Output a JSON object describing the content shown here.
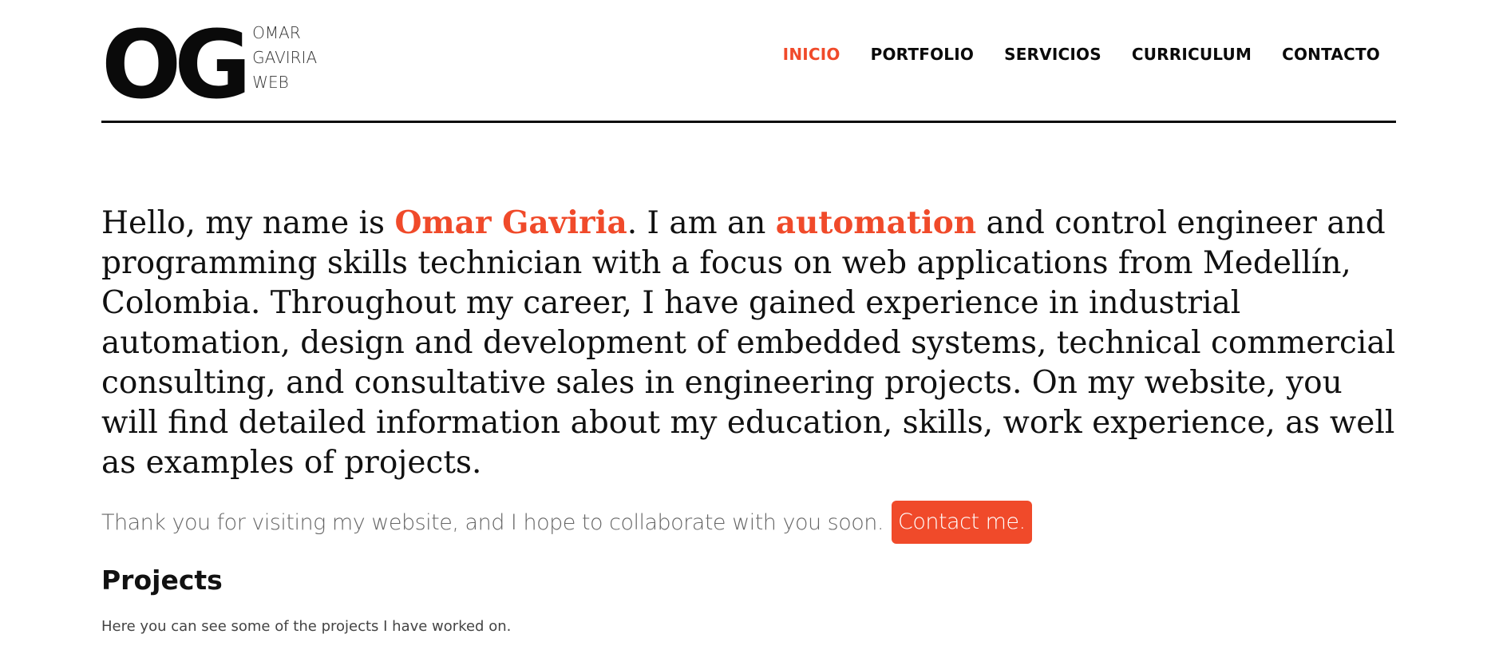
{
  "logo": {
    "mark": "OG",
    "line1": "OMAR",
    "line2": "GAVIRIA",
    "line3": "WEB"
  },
  "nav": {
    "items": [
      {
        "label": "INICIO",
        "active": true
      },
      {
        "label": "PORTFOLIO",
        "active": false
      },
      {
        "label": "SERVICIOS",
        "active": false
      },
      {
        "label": "CURRICULUM",
        "active": false
      },
      {
        "label": "CONTACTO",
        "active": false
      }
    ]
  },
  "intro": {
    "part1": "Hello, my name is ",
    "name": "Omar Gaviria",
    "part2": ". I am an ",
    "highlight": "automation",
    "part3": " and control engineer and programming skills technician with a focus on web applications from Medellín, Colombia. Throughout my career, I have gained experience in industrial automation, design and development of embedded systems, technical commercial consulting, and consultative sales in engineering projects. On my website, you will find detailed information about my education, skills, work experience, as well as examples of projects."
  },
  "thanks": {
    "text": "Thank you for visiting my website, and I hope to collaborate with you soon.",
    "button_label": "Contact me."
  },
  "projects": {
    "title": "Projects",
    "subtitle": "Here you can see some of the projects I have worked on."
  },
  "colors": {
    "accent": "#f04a2a",
    "text": "#111111",
    "muted": "#666666"
  }
}
